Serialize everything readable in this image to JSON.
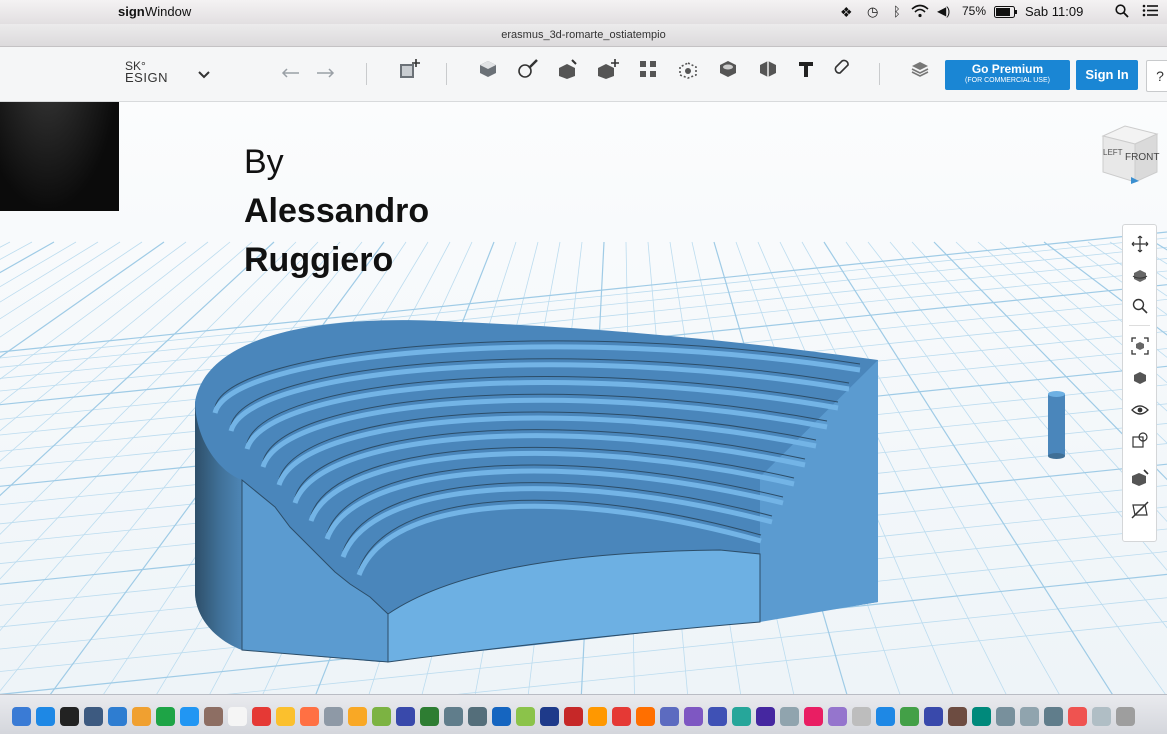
{
  "menubar": {
    "app_menu_fragment": "sign",
    "window_menu": "Window",
    "battery_percent": "75%",
    "clock": "Sab 11:09"
  },
  "window": {
    "title": "erasmus_3d-romarte_ostiatempio"
  },
  "toolbar": {
    "logo_line1": "SK°",
    "logo_line2": "ESIGN",
    "premium_label": "Go Premium",
    "premium_sub": "(FOR COMMERCIAL USE)",
    "signin_label": "Sign In",
    "help_label": "?"
  },
  "viewcube": {
    "left_face": "LEFT",
    "front_face": "FRONT"
  },
  "overlay": {
    "by": "By",
    "author_first": "Alessandro",
    "author_last": "Ruggiero"
  },
  "colors": {
    "model_blue": "#5b9bd0",
    "premium_green": "#2ba24c",
    "signin_blue": "#1a86d4",
    "grid_line": "#bcdcef"
  }
}
